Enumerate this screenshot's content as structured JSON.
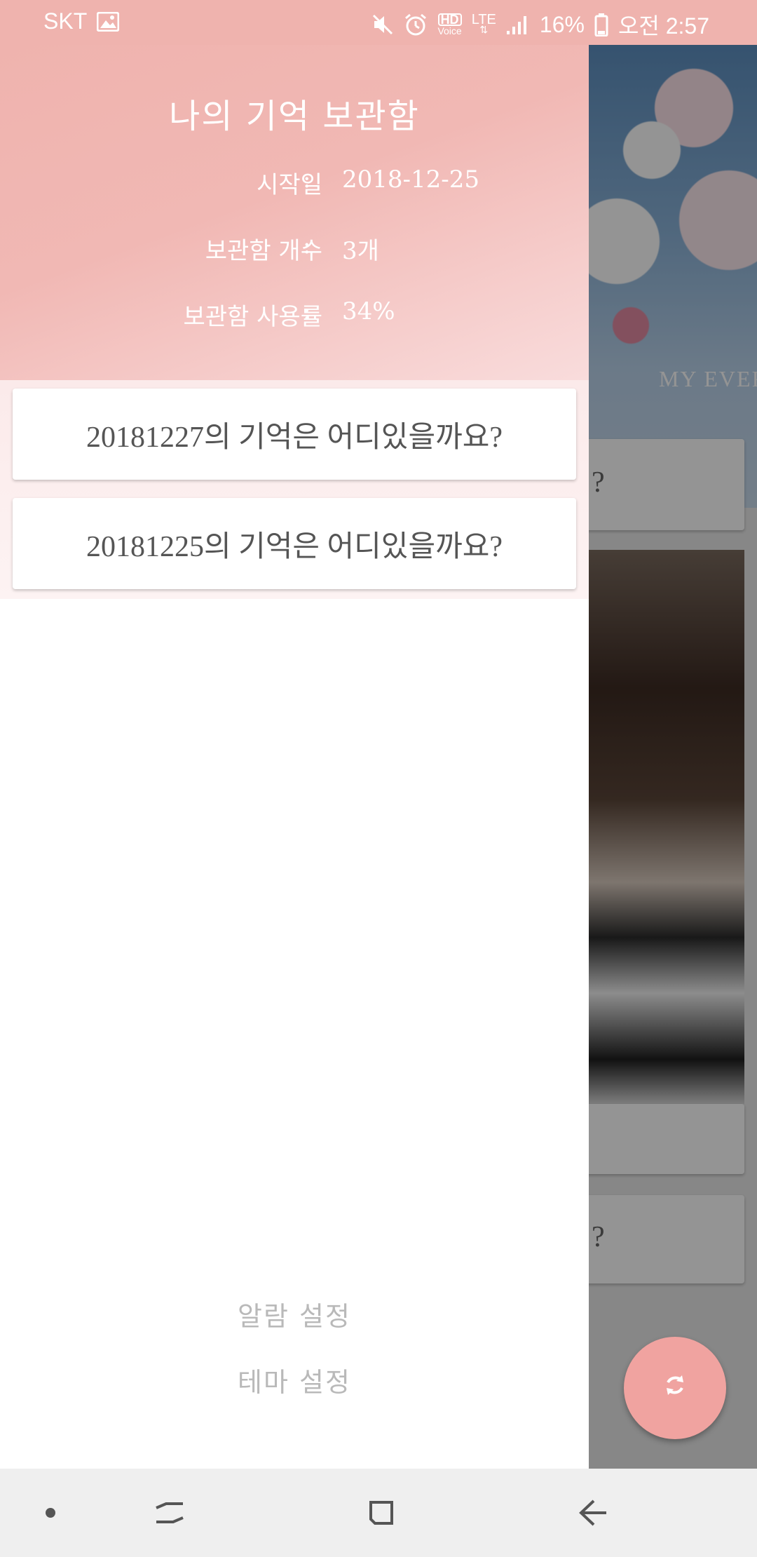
{
  "status_bar": {
    "carrier": "SKT",
    "hd_label": "HD",
    "voice_label": "Voice",
    "lte_label": "LTE",
    "battery": "16%",
    "time": "오전 2:57"
  },
  "background": {
    "hero_text": "MY EVER",
    "card_snippet": "?"
  },
  "drawer": {
    "title": "나의 기억 보관함",
    "info": [
      {
        "label": "시작일",
        "value": "2018-12-25"
      },
      {
        "label": "보관함 개수",
        "value": "3개"
      },
      {
        "label": "보관함 사용률",
        "value": "34%"
      }
    ],
    "colon": ":",
    "memories": [
      {
        "label": "20181227의 기억은 어디있을까요?"
      },
      {
        "label": "20181225의 기억은 어디있을까요?"
      }
    ],
    "menu": [
      {
        "label": "알람 설정"
      },
      {
        "label": "테마 설정"
      }
    ]
  },
  "colors": {
    "accent": "#efb3ae",
    "fab": "#f0a3a0",
    "menu_text": "#b9b9b9"
  },
  "icons": {
    "status_left": [
      "image-icon"
    ],
    "status_right": [
      "mute-icon",
      "alarm-icon",
      "hd-voice-icon",
      "lte-icon",
      "signal-icon",
      "battery-icon"
    ],
    "fab": "refresh-icon",
    "nav": [
      "dot-icon",
      "recents-icon",
      "home-icon",
      "back-icon"
    ]
  }
}
